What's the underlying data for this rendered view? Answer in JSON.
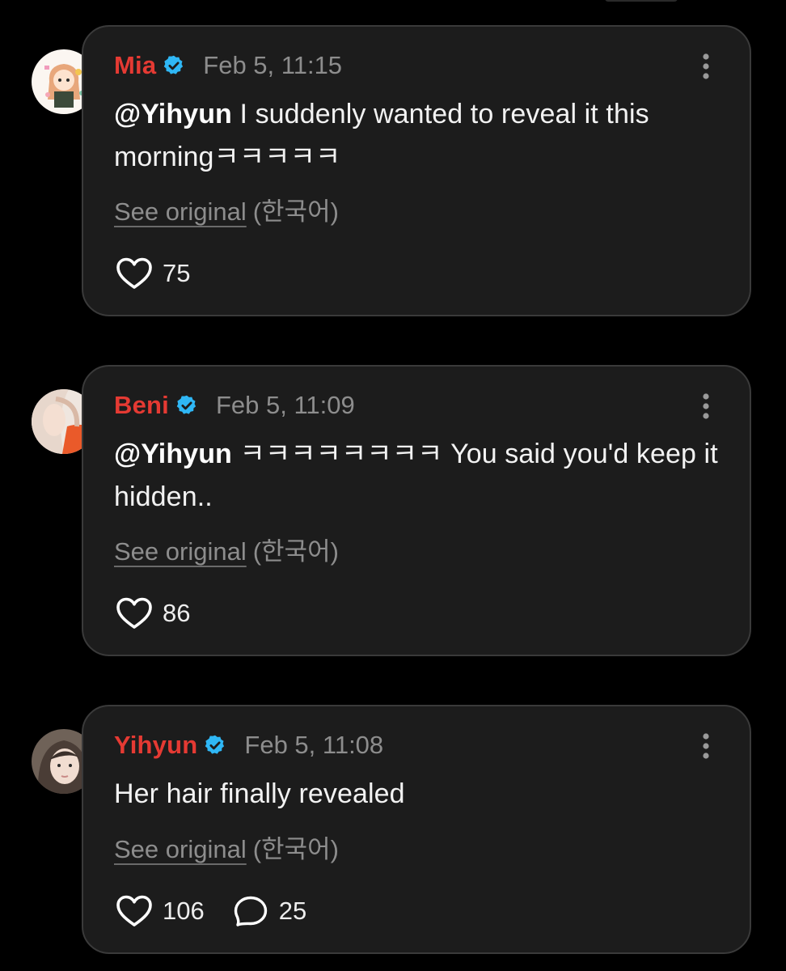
{
  "colors": {
    "background": "#000000",
    "card": "#1c1c1c",
    "card_border": "#3a3a3a",
    "username": "#e53a33",
    "verified": "#2fb7f5",
    "muted": "#8d8d8d",
    "text": "#f2f2f2"
  },
  "posts": [
    {
      "username": "Mia",
      "timestamp": "Feb 5, 11:15",
      "mention": "@Yihyun",
      "text": " I suddenly wanted to reveal it this morningㅋㅋㅋㅋㅋ",
      "see_original": "See original",
      "language": "(한국어)",
      "likes": "75",
      "replies": null
    },
    {
      "username": "Beni",
      "timestamp": "Feb 5, 11:09",
      "mention": "@Yihyun",
      "text": " ㅋㅋㅋㅋㅋㅋㅋㅋ You said you'd keep it hidden..",
      "see_original": "See original",
      "language": "(한국어)",
      "likes": "86",
      "replies": null
    },
    {
      "username": "Yihyun",
      "timestamp": "Feb 5, 11:08",
      "mention": "",
      "text": "Her hair finally revealed",
      "see_original": "See original",
      "language": "(한국어)",
      "likes": "106",
      "replies": "25"
    }
  ],
  "icons": {
    "verified": "verified-badge-icon",
    "more": "more-vertical-icon",
    "like": "heart-icon",
    "reply": "speech-bubble-icon"
  }
}
